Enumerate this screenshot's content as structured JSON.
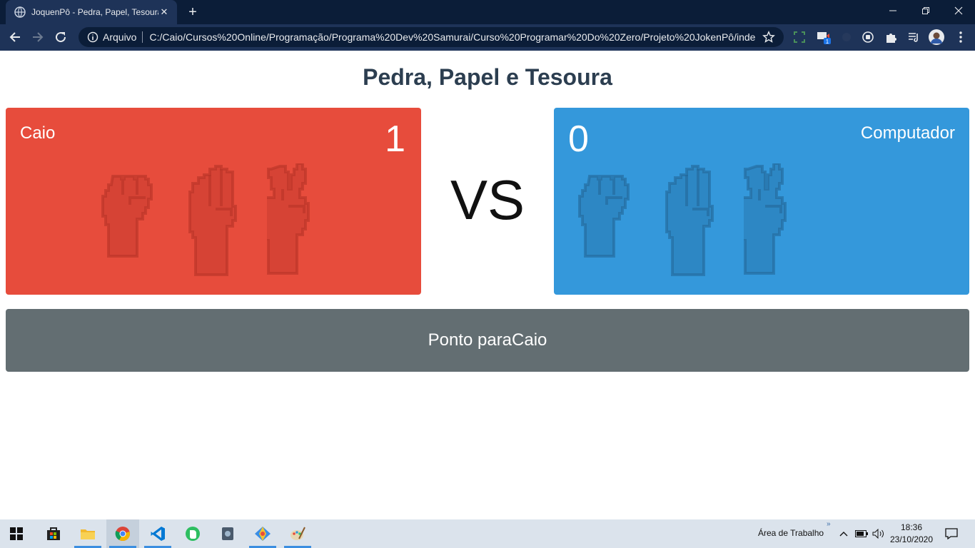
{
  "browser": {
    "tab_title": "JoquenPô - Pedra, Papel, Tesoura",
    "new_tab": "+",
    "security_label": "Arquivo",
    "url": "C:/Caio/Cursos%20Online/Programação/Programa%20Dev%20Samurai/Curso%20Programar%20Do%20Zero/Projeto%20JokenPô/index...",
    "extension_badge": "1"
  },
  "page": {
    "title": "Pedra, Papel e Tesoura",
    "vs": "VS",
    "result": "Ponto paraCaio"
  },
  "player": {
    "name": "Caio",
    "score": "1",
    "color": "#e74c3c"
  },
  "computer": {
    "name": "Computador",
    "score": "0",
    "color": "#3498db"
  },
  "hands": [
    "rock-icon",
    "paper-icon",
    "scissors-icon"
  ],
  "taskbar": {
    "desktop_label": "Área de Trabalho",
    "time": "18:36",
    "date": "23/10/2020"
  }
}
